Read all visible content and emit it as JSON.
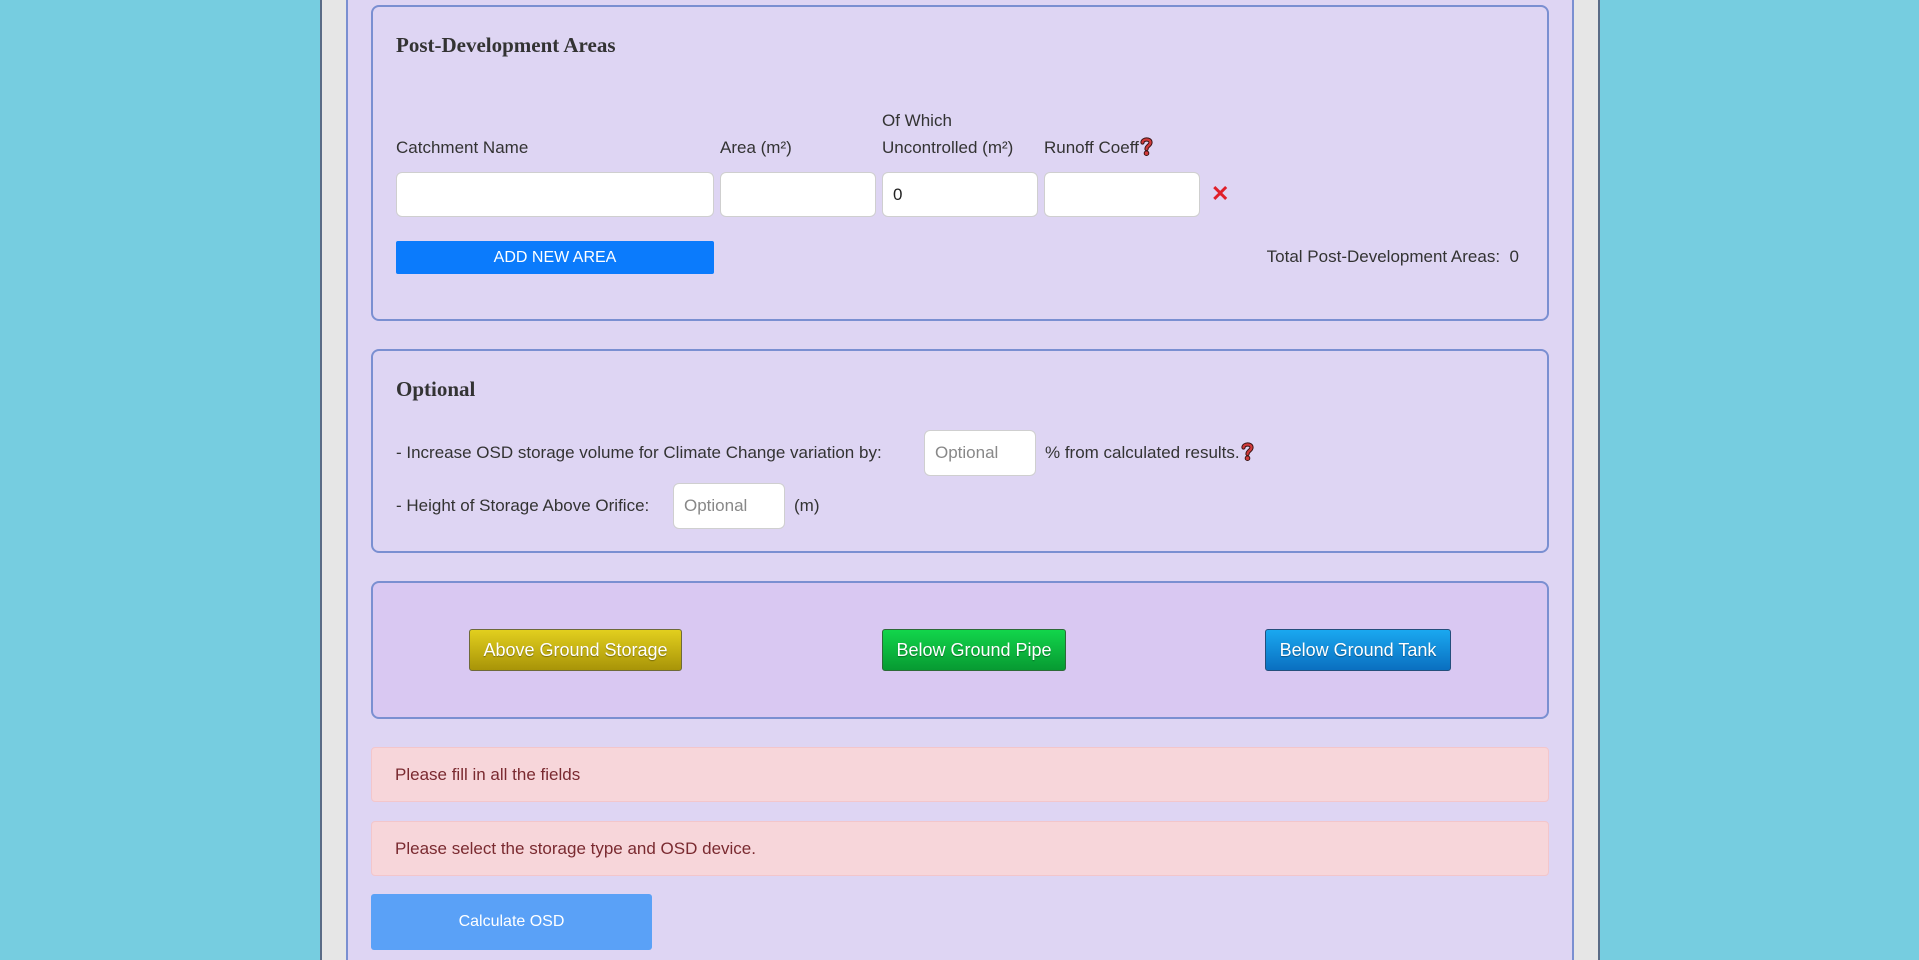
{
  "post_dev": {
    "title": "Post-Development Areas",
    "col_name": "Catchment Name",
    "col_area": "Area (m²)",
    "col_uncontrolled_1": "Of Which",
    "col_uncontrolled_2": "Uncontrolled (m²)",
    "col_runoff": "Runoff Coeff",
    "row": {
      "name": "",
      "area": "",
      "uncontrolled": "0",
      "runoff": ""
    },
    "remove_symbol": "✕",
    "add_button": "ADD NEW AREA",
    "total_label": "Total Post-Development Areas:",
    "total_value": "0"
  },
  "optional": {
    "title": "Optional",
    "climate_label": "- Increase OSD storage volume for Climate Change variation by:",
    "climate_placeholder": "Optional",
    "climate_suffix": "% from calculated results.",
    "height_label": "- Height of Storage Above Orifice:",
    "height_placeholder": "Optional",
    "height_unit": "(m)"
  },
  "storage": {
    "above": "Above Ground Storage",
    "pipe": "Below Ground Pipe",
    "tank": "Below Ground Tank"
  },
  "alerts": {
    "fill_fields": "Please fill in all the fields",
    "select_storage": "Please select the storage type and OSD device."
  },
  "calculate_button": "Calculate OSD",
  "icons": {
    "help": "question-mark-icon",
    "remove": "close-icon"
  },
  "colors": {
    "page_bg": "#76cde0",
    "panel_bg": "#ded5f3",
    "add_button": "#0b7bfc",
    "above_button": "#c9b510",
    "pipe_button": "#0fbd40",
    "tank_button": "#128ad8",
    "alert_bg": "#f7d6da",
    "calculate_button": "#5aa1f7"
  }
}
